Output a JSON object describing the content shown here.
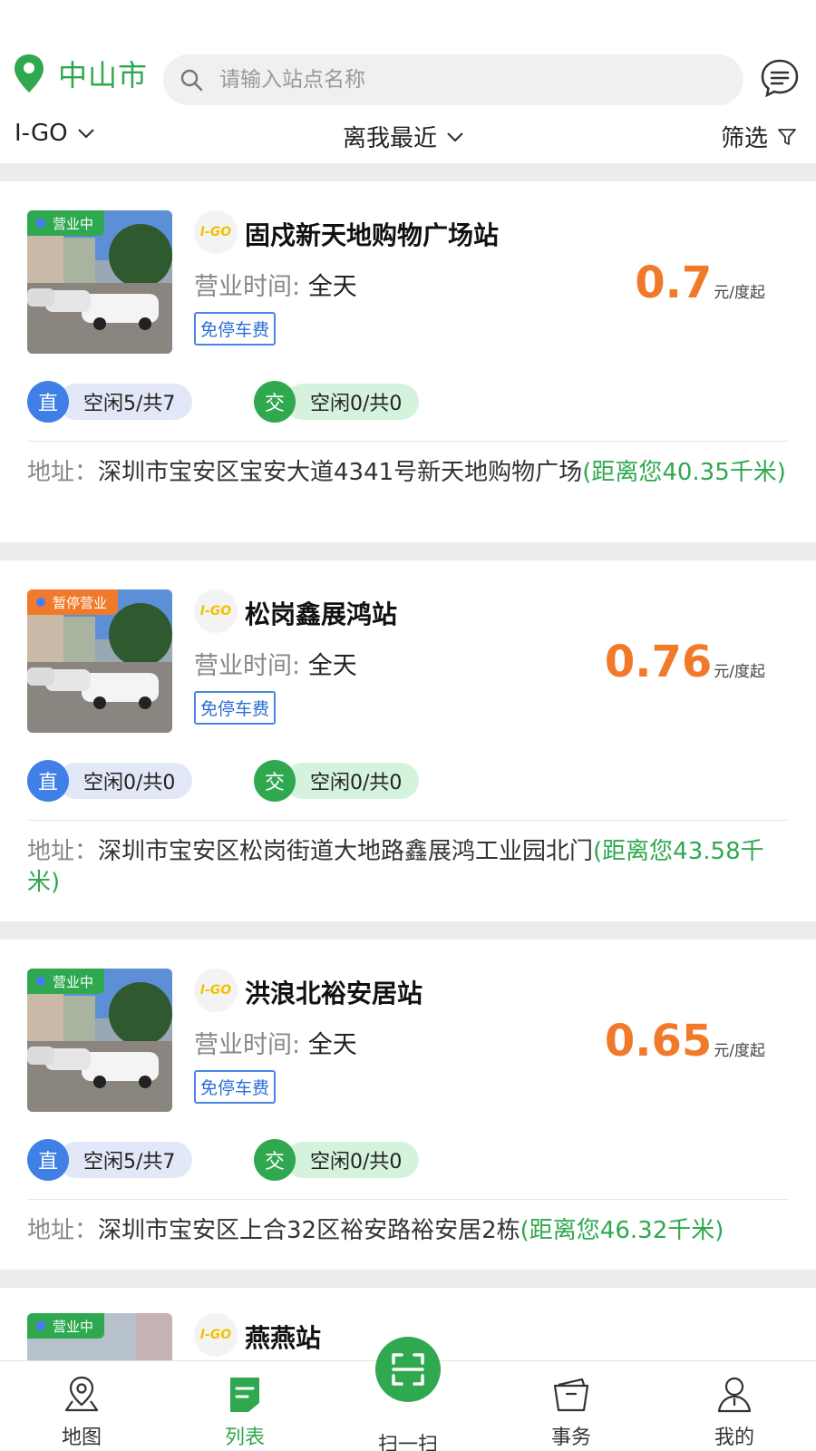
{
  "header": {
    "city": "中山市",
    "search_placeholder": "请输入站点名称",
    "brand_filter": "I-GO",
    "sort_filter": "离我最近",
    "screen_filter": "筛选"
  },
  "colors": {
    "accent_green": "#2fa84f",
    "price_orange": "#f07a2a",
    "dc_blue": "#3f7fe6",
    "tag_blue": "#2a6fd6"
  },
  "stations": [
    {
      "status": "营业中",
      "logo": "I-GO",
      "name": "固戍新天地购物广场站",
      "hours_label": "营业时间:",
      "hours_value": "全天",
      "price": "0.7",
      "price_unit": "元/度起",
      "tag": "免停车费",
      "dc_icon": "直",
      "dc_text": "空闲5/共7",
      "ac_icon": "交",
      "ac_text": "空闲0/共0",
      "addr_label": "地址：",
      "address": "深圳市宝安区宝安大道4341号新天地购物广场",
      "distance": "(距离您40.35千米)"
    },
    {
      "status": "暂停营业",
      "logo": "I-GO",
      "name": "松岗鑫展鸿站",
      "hours_label": "营业时间:",
      "hours_value": "全天",
      "price": "0.76",
      "price_unit": "元/度起",
      "tag": "免停车费",
      "dc_icon": "直",
      "dc_text": "空闲0/共0",
      "ac_icon": "交",
      "ac_text": "空闲0/共0",
      "addr_label": "地址：",
      "address": "深圳市宝安区松岗街道大地路鑫展鸿工业园北门",
      "distance": "(距离您43.58千米)"
    },
    {
      "status": "营业中",
      "logo": "I-GO",
      "name": "洪浪北裕安居站",
      "hours_label": "营业时间:",
      "hours_value": "全天",
      "price": "0.65",
      "price_unit": "元/度起",
      "tag": "免停车费",
      "dc_icon": "直",
      "dc_text": "空闲5/共7",
      "ac_icon": "交",
      "ac_text": "空闲0/共0",
      "addr_label": "地址：",
      "address": "深圳市宝安区上合32区裕安路裕安居2栋",
      "distance": "(距离您46.32千米)"
    },
    {
      "status": "营业中",
      "logo": "I-GO",
      "name": "燕燕站"
    }
  ],
  "tabbar": {
    "map": "地图",
    "list": "列表",
    "scan": "扫一扫",
    "affairs": "事务",
    "mine": "我的"
  }
}
